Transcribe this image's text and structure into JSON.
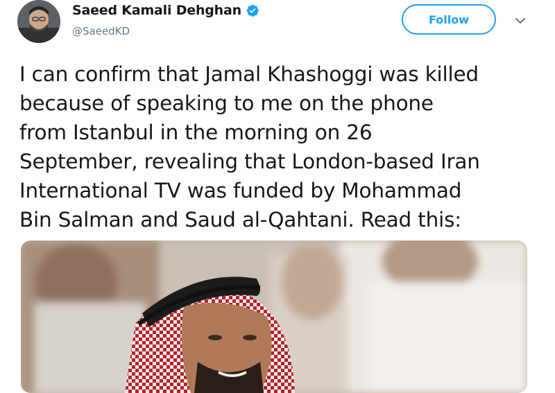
{
  "author": {
    "display_name": "Saeed Kamali Dehghan",
    "handle": "@SaeedKD",
    "verified": true
  },
  "actions": {
    "follow_label": "Follow"
  },
  "icons": {
    "verified": "verified-badge-icon",
    "caret": "chevron-down-icon"
  },
  "tweet": {
    "text": "I can confirm that Jamal Khashoggi was killed\nbecause of speaking to me on the phone\nfrom Istanbul in the morning on 26\nSeptember, revealing that London-based Iran\nInternational TV was funded by Mohammad\nBin Salman and Saud al-Qahtani. Read this:"
  },
  "colors": {
    "accent": "#1da1f2",
    "text": "#14171a",
    "muted": "#657786"
  }
}
